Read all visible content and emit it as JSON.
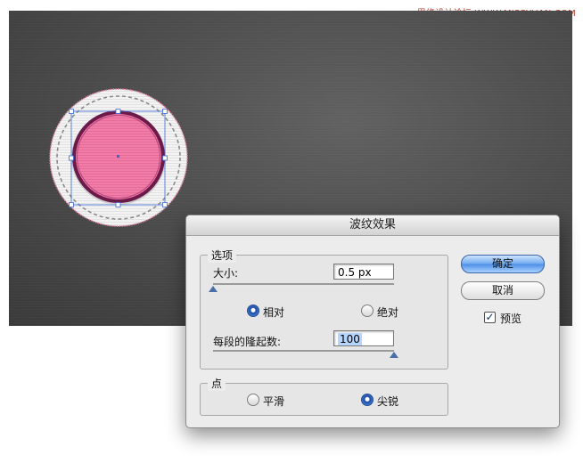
{
  "watermark": "思缘设计论坛 WWW.MISSYUAN.COM",
  "dialog": {
    "title": "波纹效果",
    "options_group": {
      "legend": "选项",
      "size_label": "大小:",
      "size_value": "0.5 px",
      "size_slider_fraction": 0.0,
      "relative_label": "相对",
      "absolute_label": "绝对",
      "selected_mode": "relative",
      "ridges_label": "每段的隆起数:",
      "ridges_value": "100",
      "ridges_slider_fraction": 1.0
    },
    "points_group": {
      "legend": "点",
      "smooth_label": "平滑",
      "corner_label": "尖锐",
      "selected_point": "corner"
    },
    "ok_label": "确定",
    "cancel_label": "取消",
    "preview_label": "预览",
    "preview_checked": true
  },
  "colors": {
    "canvas_bg": "#4a4a4a",
    "inner_circle": "#f07aa5",
    "inner_stroke": "#6b1a4a",
    "outer_disc": "#f2f2f2",
    "outer_edge": "#e07aa0",
    "selection": "#3a67d6",
    "primary_button": "#5b9be8"
  }
}
